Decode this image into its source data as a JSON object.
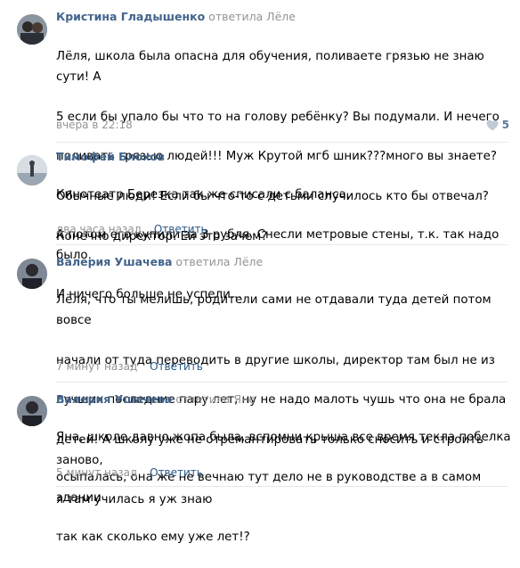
{
  "comments": [
    {
      "author": "Кристина Гладышенко",
      "reply": "ответила Лёле",
      "lines": [
        "Лёля, школа была опасна для обучения, поливаете грязью не знаю сути! А",
        "5 если бы упало бы что то на голову ребёнку? Вы подумали. И нечего",
        "поливать грязью людей!!! Муж Крутой мгб шник???много вы знаете?",
        "Обычные люди! Если бы что-то с детьми случилось кто бы отвечал?",
        "Конечно директор. Ей это зачем?"
      ],
      "time": "вчера в 22:18",
      "reply_label": "",
      "likes": "5"
    },
    {
      "author": "Тимофей Блохов",
      "reply": "",
      "lines": [
        "Кинотеатр Березка так же списали с баланса.",
        "А потом его купили за 3 рубля. Снесли метровые стены, т.к. так надо было.",
        "И ничего больше не успели..."
      ],
      "time": "два часа назад",
      "reply_label": "Ответить",
      "likes": ""
    },
    {
      "author": "Валерия Ушачева",
      "reply": "ответила Лёле",
      "lines": [
        "Лёля, что ты мелишь, родители сами не отдавали туда детей потом вовсе",
        "начали от туда переводить в другие школы, директор там был не из",
        "лучших последние пару лет, ну не надо малоть чушь что она не брала",
        "детей! А школу уже не отремантировать только сносить и строить заново,",
        "я там училась я уж знаю"
      ],
      "time": "7 минут назад",
      "reply_label": "Ответить",
      "likes": ""
    },
    {
      "author": "Валерия Ушачева",
      "reply": "ответила Яне",
      "lines": [
        "Яна, школе давно жопа была, вспомни крыша все время текла побелка",
        "осыпалась, она же не вечнаю тут дело не в руководстве а в самом здании",
        "так как сколько ему уже лет!?"
      ],
      "time": "5 минут назад",
      "reply_label": "Ответить",
      "likes": ""
    }
  ],
  "colors": {
    "author": "#42648b",
    "muted": "#939393",
    "link": "#2a5885",
    "separator": "#e7e8ec"
  }
}
